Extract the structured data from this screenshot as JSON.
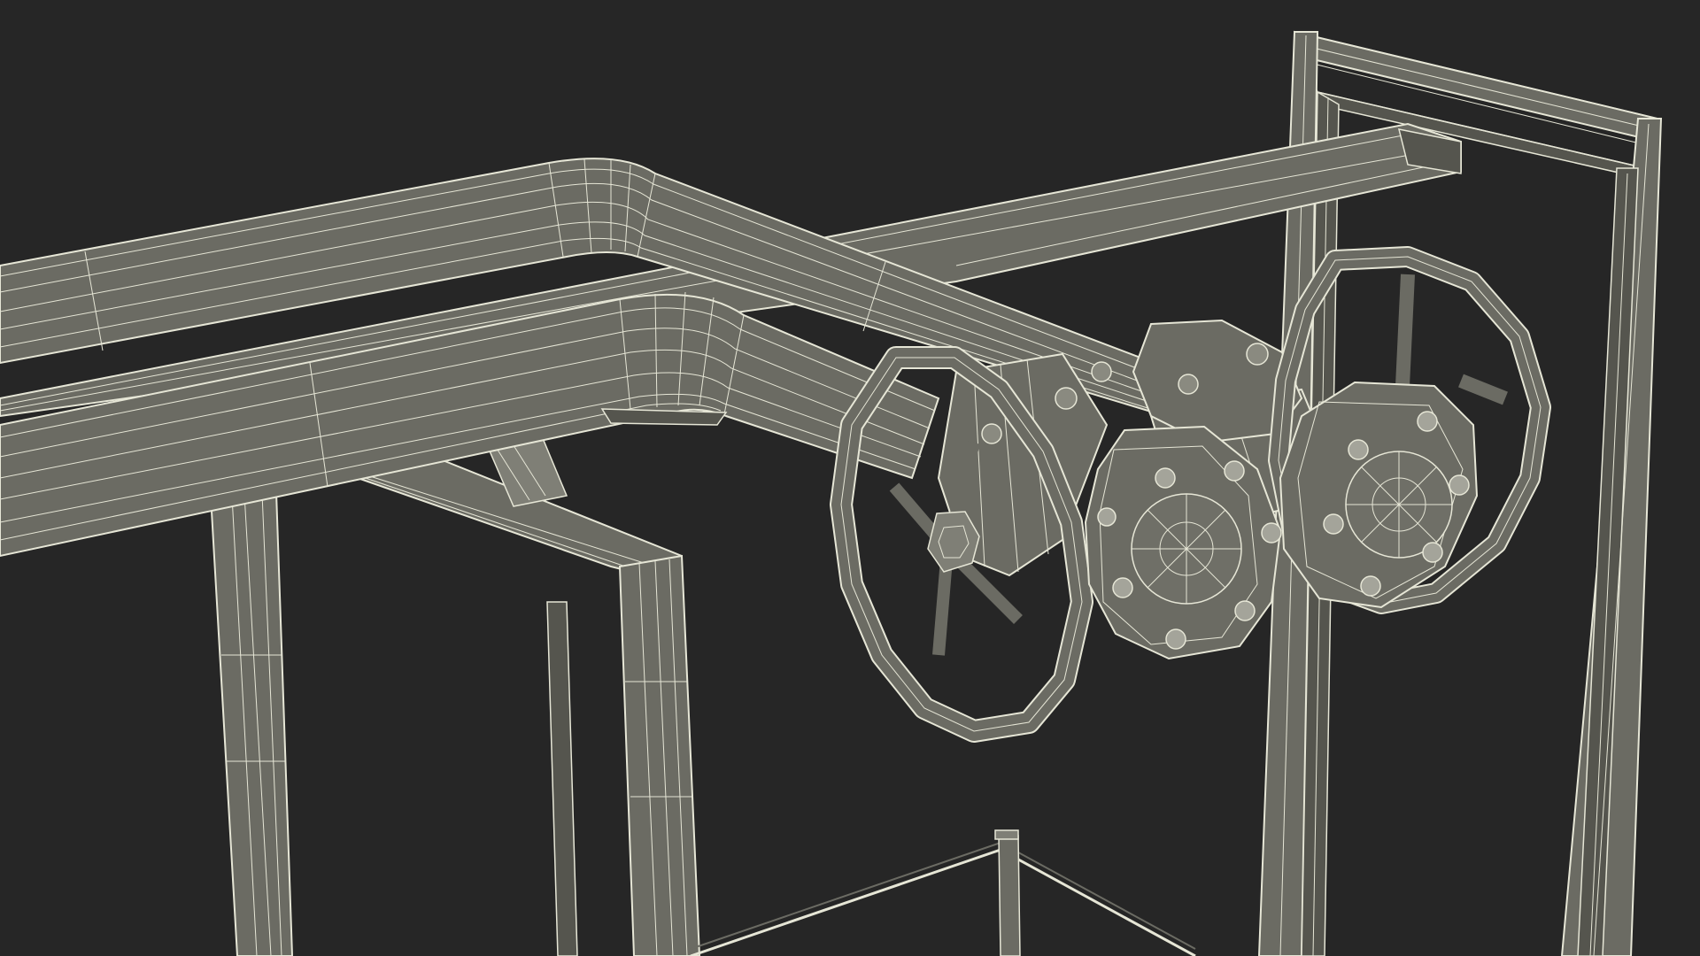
{
  "scene": {
    "description_visible_text": "",
    "background_color": "#262626",
    "mesh_fill_color": "#6b6b63",
    "mesh_fill_dark": "#55554e",
    "mesh_fill_light": "#7f7f76",
    "wire_color": "#e6e6d6",
    "objects": [
      "upper-pipe",
      "lower-pipe",
      "support-beam",
      "left-frame",
      "middle-frame",
      "right-frame",
      "left-valve-handwheel",
      "right-valve-handwheel",
      "left-flange",
      "right-flange",
      "floor-rail"
    ]
  }
}
